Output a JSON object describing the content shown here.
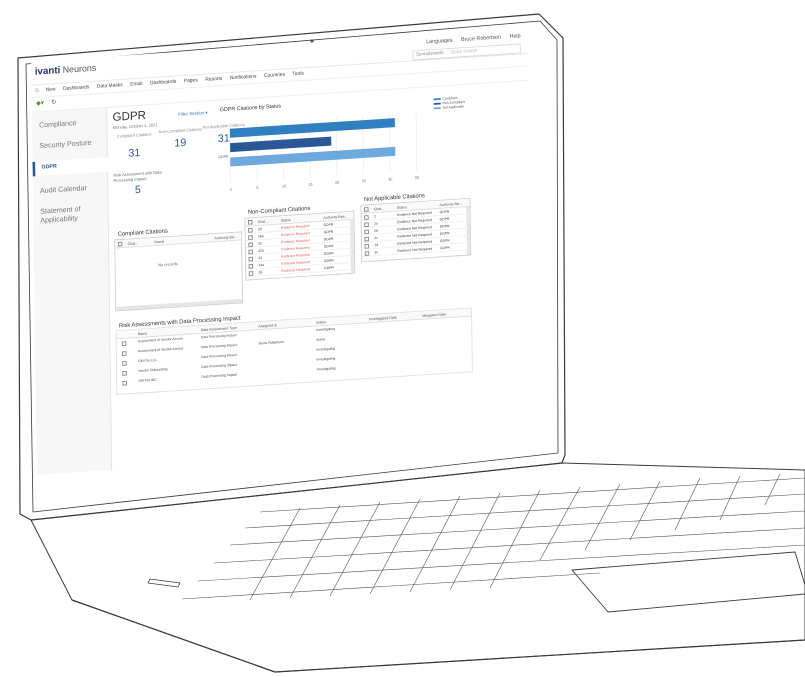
{
  "app": {
    "brand": "ivanti",
    "product": "Neurons",
    "utility": [
      "Languages",
      "Bruce Robertson",
      "Help"
    ],
    "search_category": "Spreadsheets",
    "search_placeholder": "Quick Search",
    "nav": [
      "New",
      "Dashboards",
      "Data Masks",
      "Email",
      "Dashboards",
      "Pages",
      "Reports",
      "Notifications",
      "Countries",
      "Tools"
    ]
  },
  "sidebar": {
    "items": [
      "Compliance",
      "Security Posture",
      "GDPR",
      "Audit Calendar",
      "Statement of",
      "Applicability"
    ],
    "active": "GDPR"
  },
  "main": {
    "title": "GDPR",
    "subtitle": "Monday, October 4, 2021",
    "filter_link": "Filter Section ▾",
    "stats": [
      {
        "label": "Compliant Citations",
        "value": "31"
      },
      {
        "label": "Non-Compliant Citations",
        "value": "19"
      },
      {
        "label": "Not Applicable Citations",
        "value": "31"
      }
    ],
    "risk_label": "Risk Assessment with Data Processing Impact",
    "risk_value": "5"
  },
  "chart_data": {
    "type": "bar",
    "title": "GDPR Citations by Status",
    "categories": [
      "GDPR"
    ],
    "series": [
      {
        "name": "Compliant",
        "values": [
          31
        ]
      },
      {
        "name": "Non-Compliant",
        "values": [
          19
        ]
      },
      {
        "name": "Not Applicable",
        "values": [
          31
        ]
      }
    ],
    "xticks": [
      "0",
      "5",
      "10",
      "15",
      "20",
      "25",
      "30",
      "35"
    ],
    "xlim": [
      0,
      35
    ],
    "legend_position": "right",
    "colors": [
      "#2f7fc1",
      "#2b5797",
      "#6fa8dc"
    ]
  },
  "grids": {
    "compliant": {
      "title": "Compliant Citations",
      "cols": [
        "Chal...",
        "Status",
        "Authority Ba..."
      ],
      "empty": "No records"
    },
    "noncompliant": {
      "title": "Non-Compliant Citations",
      "cols": [
        "Chal...",
        "Status",
        "Authority Bas..."
      ],
      "rows": [
        [
          "28",
          "Evidence Required",
          "GDPR"
        ],
        [
          "28a",
          "Evidence Required",
          "GDPR"
        ],
        [
          "32",
          "Evidence Required",
          "GDPR"
        ],
        [
          "32a",
          "Evidence Required",
          "GDPR"
        ],
        [
          "33",
          "Evidence Required",
          "GDPR"
        ],
        [
          "33a",
          "Evidence Required",
          "GDPR"
        ],
        [
          "35",
          "Evidence Required",
          "GDPR"
        ]
      ]
    },
    "notapplicable": {
      "title": "Not Applicable Citations",
      "cols": [
        "Chal...",
        "Status",
        "Authority Ba..."
      ],
      "rows": [
        [
          "2",
          "Evidence Not Required",
          "GDPR"
        ],
        [
          "2a",
          "Evidence Not Required",
          "GDPR"
        ],
        [
          "2b",
          "Evidence Not Required",
          "GDPR"
        ],
        [
          "2c",
          "Evidence Not Required",
          "GDPR"
        ],
        [
          "2d",
          "Evidence Not Required",
          "GDPR"
        ],
        [
          "2e",
          "Evidence Not Required",
          "GDPR"
        ]
      ]
    },
    "risk": {
      "title": "Risk Assessments with Data Processing Impact",
      "cols": [
        "Name",
        "Data Assessment Type",
        "Assigned to",
        "Status",
        "Investigated Date",
        "Mitigation Date"
      ],
      "rows": [
        [
          "Assessment of Vendor Access",
          "Data Processing Impact",
          "",
          "Investigating",
          "",
          ""
        ],
        [
          "Assessment of Vendor Access",
          "Data Processing Impact",
          "Bruce Robertson",
          "Active",
          "",
          ""
        ],
        [
          "GM Pro LLC",
          "Data Processing Impact",
          "",
          "Investigating",
          "",
          ""
        ],
        [
          "Vendor Onboarding",
          "Data Processing Impact",
          "",
          "Investigating",
          "",
          ""
        ],
        [
          "GM Pro INC",
          "Data Processing Impact",
          "",
          "Investigating",
          "",
          ""
        ]
      ]
    }
  }
}
